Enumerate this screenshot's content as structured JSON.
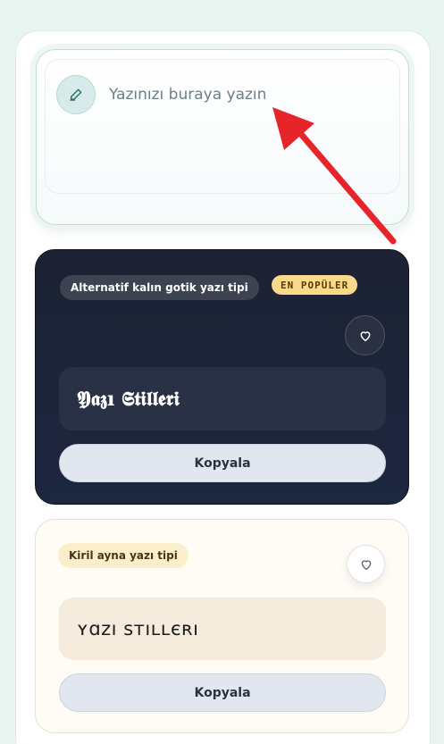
{
  "input": {
    "placeholder": "Yazınızı buraya yazın",
    "icon": "pencil-icon"
  },
  "cards": [
    {
      "tag": "Alternatif kalın gotik yazı tipi",
      "badge": "EN POPÜLER",
      "preview": "𝖄𝖆𝖟ı 𝕾𝖙𝖎𝖑𝖑𝖊𝖗𝖎",
      "copy_label": "Kopyala",
      "favorite_icon": "heart-icon"
    },
    {
      "tag": "Kiril ayna yazı tipi",
      "preview": "ʏɑzı sтıʟʟєʀı",
      "copy_label": "Kopyala",
      "favorite_icon": "heart-icon"
    }
  ],
  "colors": {
    "accent_teal": "#2f6f6a",
    "arrow_red": "#e5252a",
    "dark_card": "#1c2233",
    "badge_gold": "#f9d98a"
  }
}
